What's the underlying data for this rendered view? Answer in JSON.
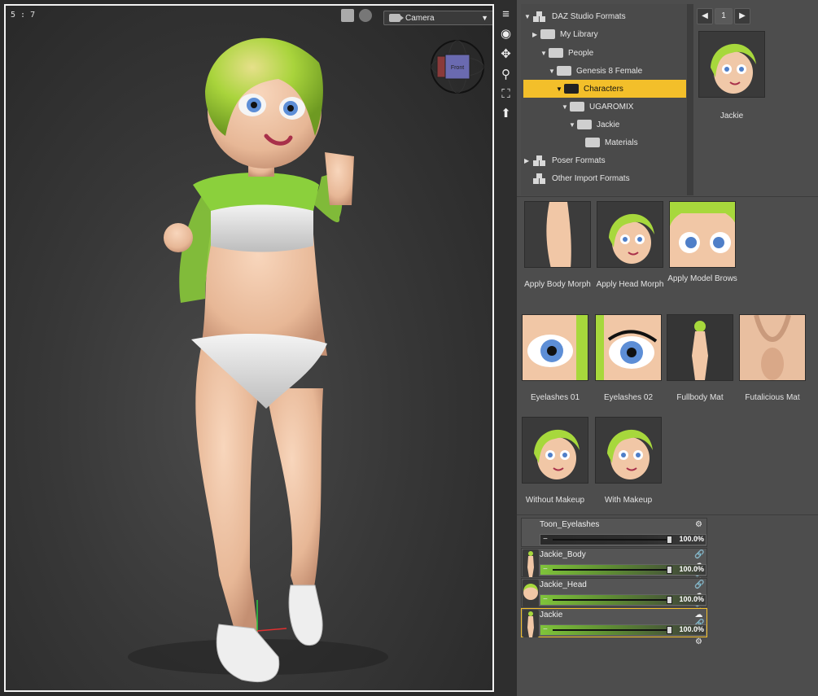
{
  "viewport": {
    "aspect_label": "5 : 7",
    "camera_select": "Camera",
    "gizmo_face": "Front"
  },
  "tree": {
    "items": [
      {
        "label": "DAZ Studio Formats",
        "arrow": "▼",
        "icon": "boxes"
      },
      {
        "label": "My Library",
        "arrow": "▶",
        "icon": "folder"
      },
      {
        "label": "People",
        "arrow": "▼",
        "icon": "folder"
      },
      {
        "label": "Genesis 8 Female",
        "arrow": "▼",
        "icon": "folder"
      },
      {
        "label": "Characters",
        "arrow": "▼",
        "icon": "folder",
        "selected": true
      },
      {
        "label": "UGAROMIX",
        "arrow": "▼",
        "icon": "folder"
      },
      {
        "label": "Jackie",
        "arrow": "▼",
        "icon": "folder"
      },
      {
        "label": "Materials",
        "arrow": "",
        "icon": "folder"
      },
      {
        "label": "Poser Formats",
        "arrow": "▶",
        "icon": "boxes"
      },
      {
        "label": "Other Import Formats",
        "arrow": "",
        "icon": "boxes"
      }
    ]
  },
  "pager": {
    "prev": "◀",
    "page": "1",
    "next": "▶"
  },
  "preview": {
    "label": "Jackie"
  },
  "thumbs": [
    {
      "label": "Apply Body Morph",
      "kind": "body"
    },
    {
      "label": "Apply Head Morph",
      "kind": "head"
    },
    {
      "label": "Apply Model Brows",
      "kind": "headclose"
    },
    {
      "label": "Eyelashes 01",
      "kind": "eye"
    },
    {
      "label": "Eyelashes 02",
      "kind": "eye2"
    },
    {
      "label": "Fullbody Mat",
      "kind": "full"
    },
    {
      "label": "Futalicious Mat",
      "kind": "skin"
    },
    {
      "label": "Without Makeup",
      "kind": "head"
    },
    {
      "label": "With Makeup",
      "kind": "head"
    }
  ],
  "layers": [
    {
      "name": "Toon_Eyelashes",
      "value": "100.0%",
      "icons": "⚙",
      "thumb": "none",
      "bar": "dark"
    },
    {
      "name": "Jackie_Body",
      "value": "100.0%",
      "icons": "🔗 ☁ 🔗 ♡ ⚙",
      "thumb": "body",
      "bar": "green"
    },
    {
      "name": "Jackie_Head",
      "value": "100.0%",
      "icons": "🔗 ☁ 🔗 ♡ ⚙",
      "thumb": "head",
      "bar": "green"
    },
    {
      "name": "Jackie",
      "value": "100.0%",
      "icons": "☁ 🔗 ♡ ⚙",
      "thumb": "body",
      "bar": "green",
      "active": true
    }
  ],
  "colors": {
    "selection": "#f3bf2a",
    "hair": "#a7d83c",
    "skin": "#f1c7a6"
  }
}
